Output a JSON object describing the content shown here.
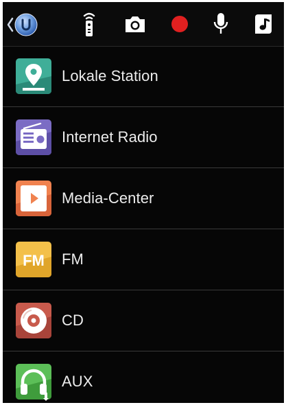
{
  "colors": {
    "background": "#060606",
    "text": "#ececec",
    "divider": "#3a3a3a",
    "record": "#e02020"
  },
  "topbar": {
    "icons": [
      "back-arrow-icon",
      "globe-u-icon",
      "remote-control-icon",
      "camera-icon",
      "record-icon",
      "microphone-icon",
      "music-note-icon"
    ]
  },
  "sources": [
    {
      "label": "Lokale Station",
      "icon": "location-pin-icon"
    },
    {
      "label": "Internet Radio",
      "icon": "radio-icon"
    },
    {
      "label": "Media-Center",
      "icon": "play-icon"
    },
    {
      "label": "FM",
      "icon": "fm-icon"
    },
    {
      "label": "CD",
      "icon": "disc-icon"
    },
    {
      "label": "AUX",
      "icon": "headphones-icon"
    }
  ]
}
